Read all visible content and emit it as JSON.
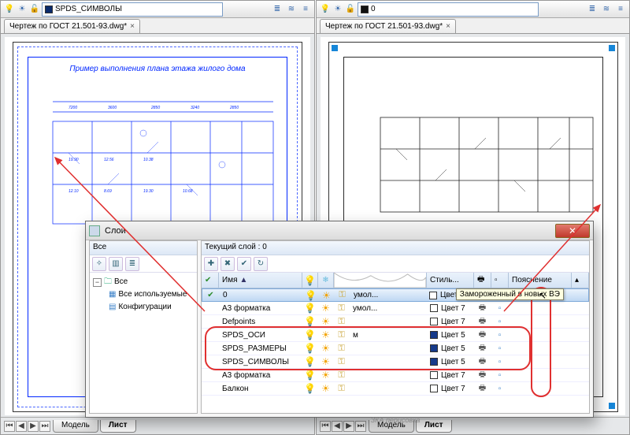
{
  "left": {
    "layer_combo": "SPDS_СИМВОЛЫ",
    "doc_tab": "Чертеж по ГОСТ 21.501-93.dwg*",
    "plan_title": "Пример выполнения плана этажа жилого дома",
    "sheets": {
      "model": "Модель",
      "sheet": "Лист"
    }
  },
  "right": {
    "layer_combo": "0",
    "doc_tab": "Чертеж по ГОСТ 21.501-93.dwg*",
    "sheets": {
      "model": "Модель",
      "sheet": "Лист"
    }
  },
  "dlg": {
    "title": "Слои",
    "tree_head": "Все",
    "current_layer_label": "Текущий слой : 0",
    "tree": {
      "root": "Все",
      "used": "Все используемые",
      "configs": "Конфигурации"
    },
    "cols": {
      "name": "Имя",
      "style": "Стиль...",
      "desc": "Пояснение"
    },
    "tooltip": "Замороженный в новых ВЭ",
    "redraw": "ЗКА перисовка",
    "rows": [
      {
        "chk": "✔",
        "name": "0",
        "torn_text": "умол...",
        "color_label": "Цвет 7",
        "swatch": "clr-default",
        "sel": true
      },
      {
        "chk": "",
        "name": "А3 форматка",
        "torn_text": "умол...",
        "color_label": "Цвет 7",
        "swatch": "clr-default",
        "sel": false
      },
      {
        "chk": "",
        "name": "Defpoints",
        "torn_text": "",
        "color_label": "Цвет 7",
        "swatch": "clr-default",
        "sel": false
      },
      {
        "chk": "",
        "name": "SPDS_ОСИ",
        "torn_text": "м",
        "color_label": "Цвет 5",
        "swatch": "clr-blue",
        "sel": false
      },
      {
        "chk": "",
        "name": "SPDS_РАЗМЕРЫ",
        "torn_text": "",
        "color_label": "Цвет 5",
        "swatch": "clr-blue",
        "sel": false
      },
      {
        "chk": "",
        "name": "SPDS_СИМВОЛЫ",
        "torn_text": "",
        "color_label": "Цвет 5",
        "swatch": "clr-blue",
        "sel": false
      },
      {
        "chk": "",
        "name": "А3 форматка",
        "torn_text": "",
        "color_label": "Цвет 7",
        "swatch": "clr-default",
        "sel": false
      },
      {
        "chk": "",
        "name": "Балкон",
        "torn_text": "",
        "color_label": "Цвет 7",
        "swatch": "clr-default",
        "sel": false
      }
    ]
  }
}
